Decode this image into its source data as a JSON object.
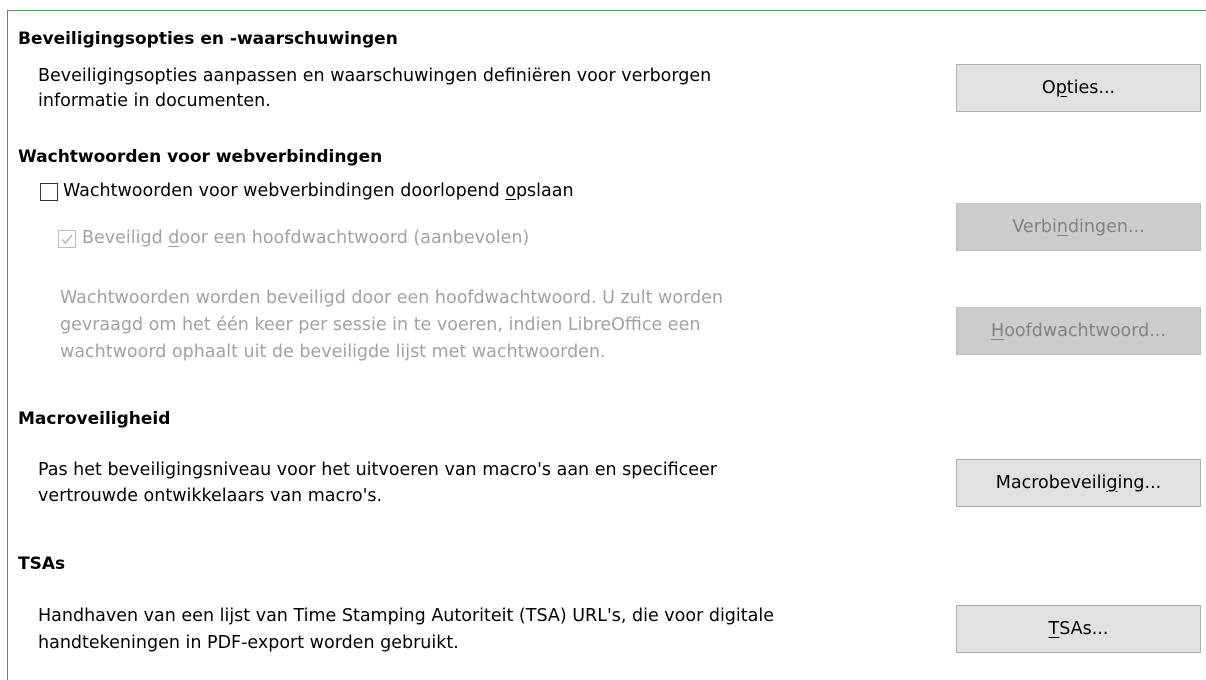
{
  "sections": {
    "security": {
      "heading": "Beveiligingsopties en -waarschuwingen",
      "desc1": "Beveiligingsopties aanpassen en waarschuwingen definiëren voor verborgen",
      "desc2": "informatie in documenten.",
      "button": {
        "pre": "O",
        "key": "p",
        "post": "ties..."
      }
    },
    "passwords": {
      "heading": "Wachtwoorden voor webverbindingen",
      "persist": {
        "pre": "Wachtwoorden voor webverbindingen doorlopend ",
        "key": "o",
        "post": "pslaan",
        "checked": false
      },
      "master": {
        "pre": "Beveiligd ",
        "key": "d",
        "post": "oor een hoofdwachtwoord (aanbevolen)",
        "checked": true,
        "disabled": true
      },
      "connections_button": {
        "pre": "Verbi",
        "key": "n",
        "post": "dingen..."
      },
      "note1": "Wachtwoorden worden beveiligd door een hoofdwachtwoord. U zult worden",
      "note2": "gevraagd om het één keer per sessie in te voeren, indien LibreOffice een",
      "note3": "wachtwoord ophaalt uit de beveiligde lijst met wachtwoorden.",
      "master_button": {
        "pre": "",
        "key": "H",
        "post": "oofdwachtwoord..."
      }
    },
    "macro": {
      "heading": "Macroveiligheid",
      "desc1": "Pas het beveiligingsniveau voor het uitvoeren van macro's aan en specificeer",
      "desc2": "vertrouwde ontwikkelaars van macro's.",
      "button": {
        "pre": "Macrobeveili",
        "key": "g",
        "post": "ing..."
      }
    },
    "tsa": {
      "heading": "TSAs",
      "desc1": "Handhaven van een lijst van Time Stamping Autoriteit (TSA) URL's, die voor digitale",
      "desc2": "handtekeningen in PDF-export worden gebruikt.",
      "button": {
        "pre": "",
        "key": "T",
        "post": "SAs..."
      }
    }
  }
}
